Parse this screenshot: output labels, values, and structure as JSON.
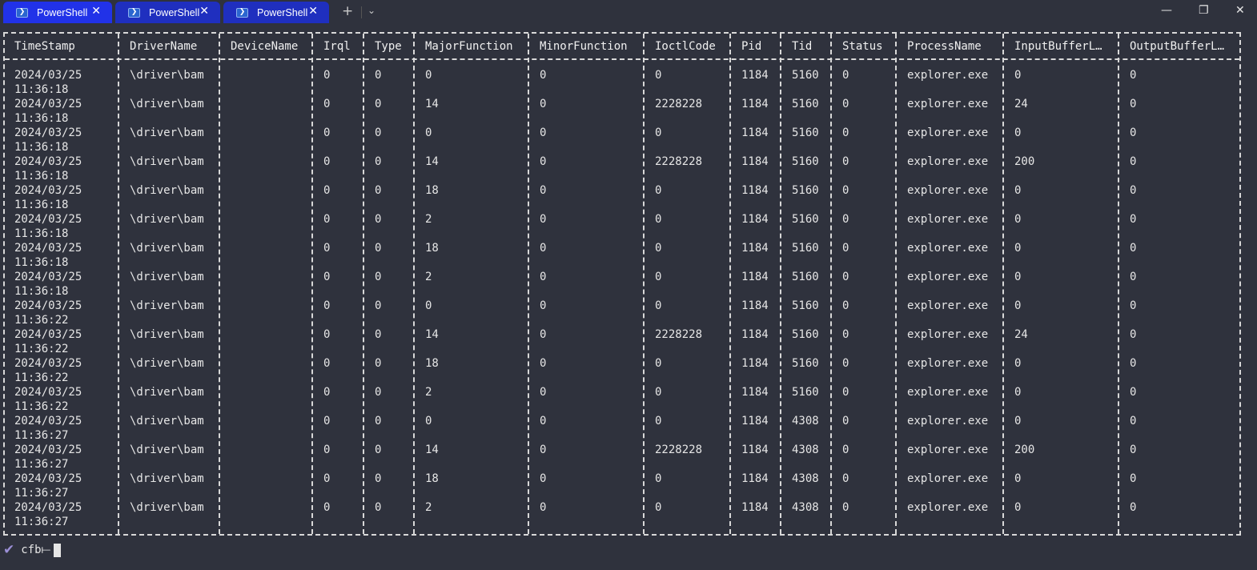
{
  "tabs": [
    {
      "label": "PowerShell",
      "active": true
    },
    {
      "label": "PowerShell",
      "active": false
    },
    {
      "label": "PowerShell",
      "active": false
    }
  ],
  "titlebar": {
    "new_tab_glyph": "+",
    "dropdown_glyph": "⌄",
    "minimize_glyph": "—",
    "maximize_glyph": "❐",
    "close_glyph": "✕",
    "tab_close_glyph": "✕"
  },
  "table": {
    "headers": [
      "TimeStamp",
      "DriverName",
      "DeviceName",
      "Irql",
      "Type",
      "MajorFunction",
      "MinorFunction",
      "IoctlCode",
      "Pid",
      "Tid",
      "Status",
      "ProcessName",
      "InputBufferL…",
      "OutputBufferL…"
    ],
    "rows": [
      {
        "date": "2024/03/25",
        "time": "11:36:18",
        "driver": "\\driver\\bam",
        "device": "",
        "irql": "0",
        "type": "0",
        "major": "0",
        "minor": "0",
        "ioctl": "0",
        "pid": "1184",
        "tid": "5160",
        "status": "0",
        "process": "explorer.exe",
        "inlen": "0",
        "outlen": "0"
      },
      {
        "date": "2024/03/25",
        "time": "11:36:18",
        "driver": "\\driver\\bam",
        "device": "",
        "irql": "0",
        "type": "0",
        "major": "14",
        "minor": "0",
        "ioctl": "2228228",
        "pid": "1184",
        "tid": "5160",
        "status": "0",
        "process": "explorer.exe",
        "inlen": "24",
        "outlen": "0"
      },
      {
        "date": "2024/03/25",
        "time": "11:36:18",
        "driver": "\\driver\\bam",
        "device": "",
        "irql": "0",
        "type": "0",
        "major": "0",
        "minor": "0",
        "ioctl": "0",
        "pid": "1184",
        "tid": "5160",
        "status": "0",
        "process": "explorer.exe",
        "inlen": "0",
        "outlen": "0"
      },
      {
        "date": "2024/03/25",
        "time": "11:36:18",
        "driver": "\\driver\\bam",
        "device": "",
        "irql": "0",
        "type": "0",
        "major": "14",
        "minor": "0",
        "ioctl": "2228228",
        "pid": "1184",
        "tid": "5160",
        "status": "0",
        "process": "explorer.exe",
        "inlen": "200",
        "outlen": "0"
      },
      {
        "date": "2024/03/25",
        "time": "11:36:18",
        "driver": "\\driver\\bam",
        "device": "",
        "irql": "0",
        "type": "0",
        "major": "18",
        "minor": "0",
        "ioctl": "0",
        "pid": "1184",
        "tid": "5160",
        "status": "0",
        "process": "explorer.exe",
        "inlen": "0",
        "outlen": "0"
      },
      {
        "date": "2024/03/25",
        "time": "11:36:18",
        "driver": "\\driver\\bam",
        "device": "",
        "irql": "0",
        "type": "0",
        "major": "2",
        "minor": "0",
        "ioctl": "0",
        "pid": "1184",
        "tid": "5160",
        "status": "0",
        "process": "explorer.exe",
        "inlen": "0",
        "outlen": "0"
      },
      {
        "date": "2024/03/25",
        "time": "11:36:18",
        "driver": "\\driver\\bam",
        "device": "",
        "irql": "0",
        "type": "0",
        "major": "18",
        "minor": "0",
        "ioctl": "0",
        "pid": "1184",
        "tid": "5160",
        "status": "0",
        "process": "explorer.exe",
        "inlen": "0",
        "outlen": "0"
      },
      {
        "date": "2024/03/25",
        "time": "11:36:18",
        "driver": "\\driver\\bam",
        "device": "",
        "irql": "0",
        "type": "0",
        "major": "2",
        "minor": "0",
        "ioctl": "0",
        "pid": "1184",
        "tid": "5160",
        "status": "0",
        "process": "explorer.exe",
        "inlen": "0",
        "outlen": "0"
      },
      {
        "date": "2024/03/25",
        "time": "11:36:22",
        "driver": "\\driver\\bam",
        "device": "",
        "irql": "0",
        "type": "0",
        "major": "0",
        "minor": "0",
        "ioctl": "0",
        "pid": "1184",
        "tid": "5160",
        "status": "0",
        "process": "explorer.exe",
        "inlen": "0",
        "outlen": "0"
      },
      {
        "date": "2024/03/25",
        "time": "11:36:22",
        "driver": "\\driver\\bam",
        "device": "",
        "irql": "0",
        "type": "0",
        "major": "14",
        "minor": "0",
        "ioctl": "2228228",
        "pid": "1184",
        "tid": "5160",
        "status": "0",
        "process": "explorer.exe",
        "inlen": "24",
        "outlen": "0"
      },
      {
        "date": "2024/03/25",
        "time": "11:36:22",
        "driver": "\\driver\\bam",
        "device": "",
        "irql": "0",
        "type": "0",
        "major": "18",
        "minor": "0",
        "ioctl": "0",
        "pid": "1184",
        "tid": "5160",
        "status": "0",
        "process": "explorer.exe",
        "inlen": "0",
        "outlen": "0"
      },
      {
        "date": "2024/03/25",
        "time": "11:36:22",
        "driver": "\\driver\\bam",
        "device": "",
        "irql": "0",
        "type": "0",
        "major": "2",
        "minor": "0",
        "ioctl": "0",
        "pid": "1184",
        "tid": "5160",
        "status": "0",
        "process": "explorer.exe",
        "inlen": "0",
        "outlen": "0"
      },
      {
        "date": "2024/03/25",
        "time": "11:36:27",
        "driver": "\\driver\\bam",
        "device": "",
        "irql": "0",
        "type": "0",
        "major": "0",
        "minor": "0",
        "ioctl": "0",
        "pid": "1184",
        "tid": "4308",
        "status": "0",
        "process": "explorer.exe",
        "inlen": "0",
        "outlen": "0"
      },
      {
        "date": "2024/03/25",
        "time": "11:36:27",
        "driver": "\\driver\\bam",
        "device": "",
        "irql": "0",
        "type": "0",
        "major": "14",
        "minor": "0",
        "ioctl": "2228228",
        "pid": "1184",
        "tid": "4308",
        "status": "0",
        "process": "explorer.exe",
        "inlen": "200",
        "outlen": "0"
      },
      {
        "date": "2024/03/25",
        "time": "11:36:27",
        "driver": "\\driver\\bam",
        "device": "",
        "irql": "0",
        "type": "0",
        "major": "18",
        "minor": "0",
        "ioctl": "0",
        "pid": "1184",
        "tid": "4308",
        "status": "0",
        "process": "explorer.exe",
        "inlen": "0",
        "outlen": "0"
      },
      {
        "date": "2024/03/25",
        "time": "11:36:27",
        "driver": "\\driver\\bam",
        "device": "",
        "irql": "0",
        "type": "0",
        "major": "2",
        "minor": "0",
        "ioctl": "0",
        "pid": "1184",
        "tid": "4308",
        "status": "0",
        "process": "explorer.exe",
        "inlen": "0",
        "outlen": "0"
      }
    ]
  },
  "prompt": {
    "check_glyph": "✔",
    "text": "cfb⟝"
  },
  "colors": {
    "background": "#2f323d",
    "tab_active": "#2132e8",
    "tab_inactive": "#1f2fbf",
    "text": "#e6e6e6",
    "check": "#9b8fd6"
  }
}
